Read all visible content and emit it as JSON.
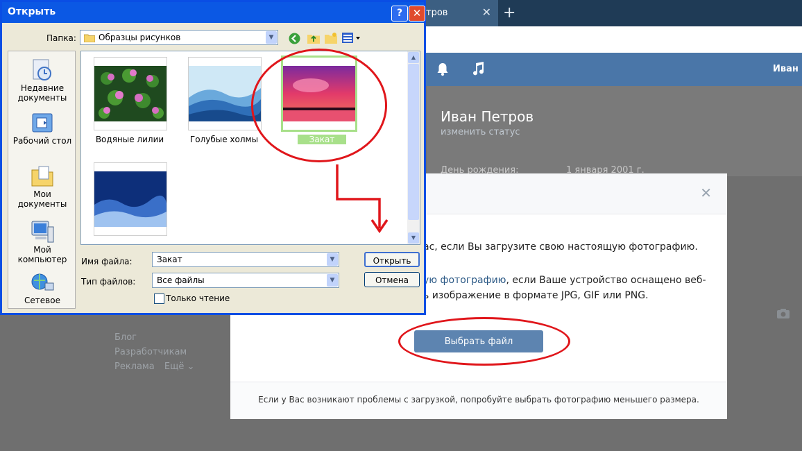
{
  "browser": {
    "tab_title": "етров",
    "tab_close": "✕",
    "new_tab": "+"
  },
  "vk": {
    "header_user": "Иван",
    "profile": {
      "name": "Иван Петров",
      "status": "изменить статус",
      "birthday_label": "День рождения:",
      "birthday_value": "1 января 2001 г."
    },
    "side_links": [
      "Блог",
      "Разработчикам",
      "Реклама",
      "Ещё ⌄"
    ]
  },
  "upload_modal": {
    "close": "✕",
    "text1": "ас, если Вы загрузите свою настоящую фотографию.",
    "text2_link": "ую фотографию",
    "text2_rest": ", если Ваше устройство оснащено веб-",
    "text3": "изображение в формате JPG, GIF или PNG.",
    "choose_button": "Выбрать файл",
    "footer": "Если у Вас возникают проблемы с загрузкой, попробуйте выбрать фотографию меньшего размера."
  },
  "dialog": {
    "title": "Открыть",
    "help": "?",
    "close": "✕",
    "folder_label": "Папка:",
    "folder_value": "Образцы рисунков",
    "places": [
      "Недавние документы",
      "Рабочий стол",
      "Мои документы",
      "Мой компьютер",
      "Сетевое"
    ],
    "files": [
      {
        "name": "Водяные лилии"
      },
      {
        "name": "Голубые холмы"
      },
      {
        "name": "Закат"
      },
      {
        "name": ""
      }
    ],
    "filename_label": "Имя файла:",
    "filename_value": "Закат",
    "filetype_label": "Тип файлов:",
    "filetype_value": "Все файлы",
    "readonly_label": "Только чтение",
    "open_button": "Открыть",
    "cancel_button": "Отмена"
  },
  "colors": {
    "vk_header": "#4a76a8",
    "annotation_red": "#e0161b",
    "xp_title_blue": "#0b58e4"
  }
}
